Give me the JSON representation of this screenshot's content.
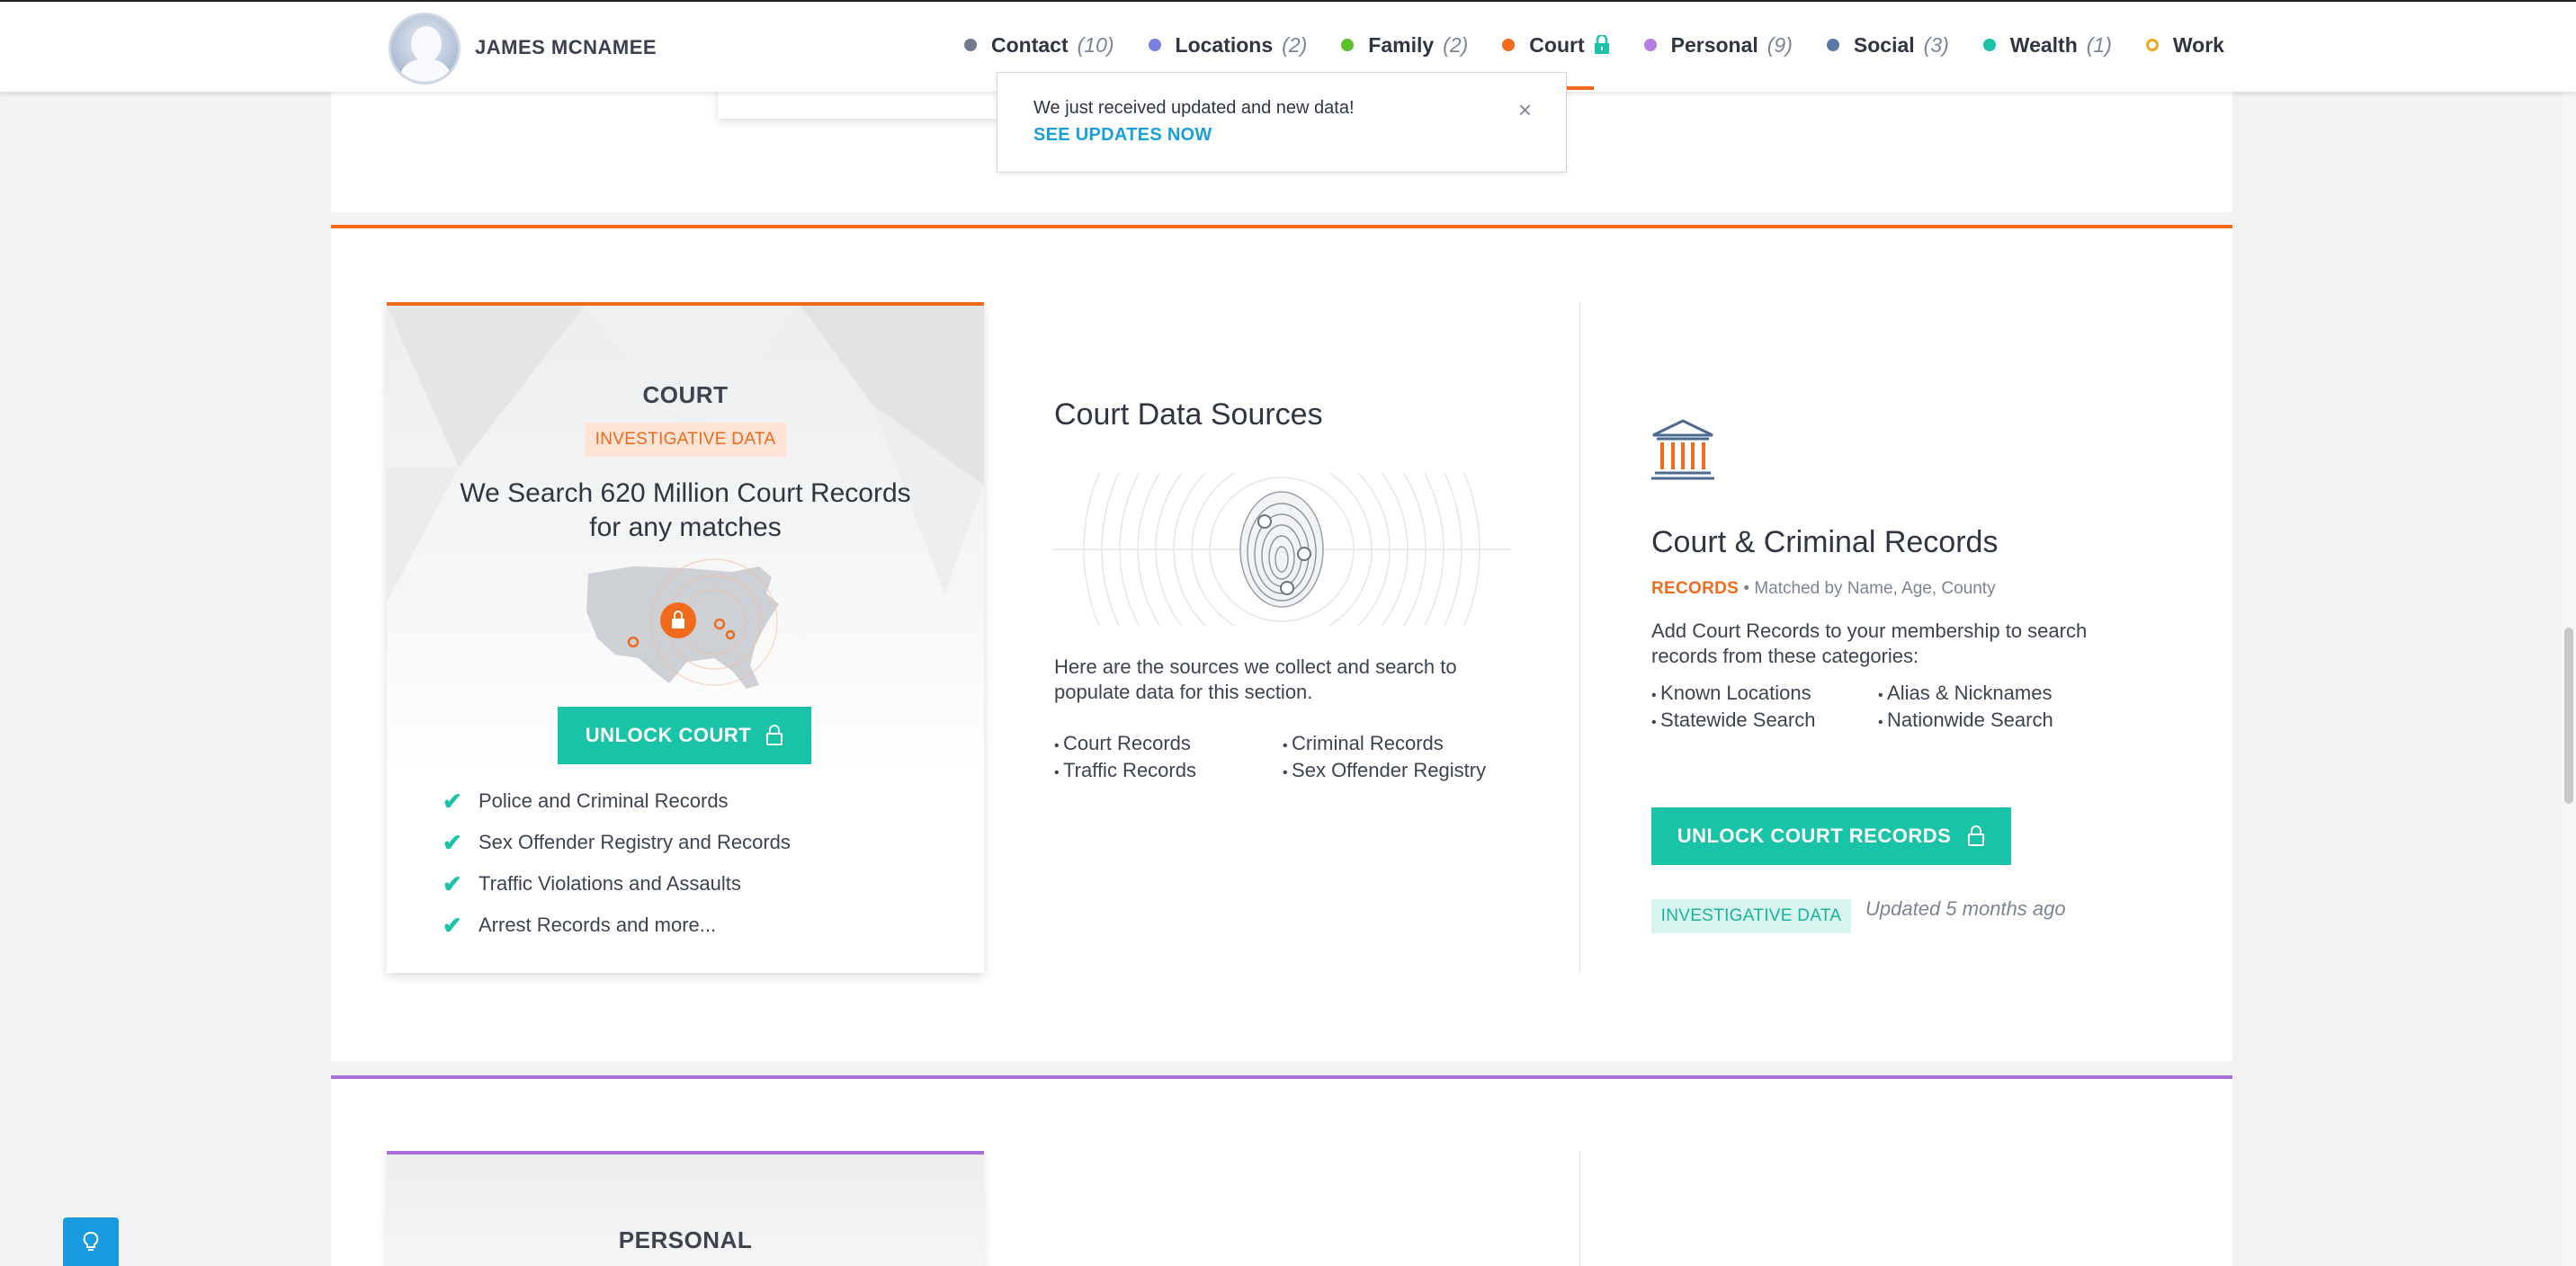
{
  "header": {
    "user_name": "JAMES MCNAMEE",
    "nav": [
      {
        "label": "Contact",
        "count": "(10)",
        "color": "#6f7a8c",
        "hollow": false,
        "locked": false
      },
      {
        "label": "Locations",
        "count": "(2)",
        "color": "#7b7fe0",
        "hollow": false,
        "locked": false
      },
      {
        "label": "Family",
        "count": "(2)",
        "color": "#5cc02e",
        "hollow": false,
        "locked": false
      },
      {
        "label": "Court",
        "count": "",
        "color": "#f26a1b",
        "hollow": false,
        "locked": true
      },
      {
        "label": "Personal",
        "count": "(9)",
        "color": "#b77de3",
        "hollow": false,
        "locked": false
      },
      {
        "label": "Social",
        "count": "(3)",
        "color": "#5a78a8",
        "hollow": false,
        "locked": false
      },
      {
        "label": "Wealth",
        "count": "(1)",
        "color": "#18c3a8",
        "hollow": false,
        "locked": false
      },
      {
        "label": "Work",
        "count": "",
        "color": "#f0a818",
        "hollow": true,
        "locked": false
      }
    ]
  },
  "notification": {
    "message": "We just received updated and new data!",
    "link": "SEE UPDATES NOW",
    "close": "×"
  },
  "court_card": {
    "title": "COURT",
    "badge": "INVESTIGATIVE DATA",
    "headline_line1": "We Search 620 Million Court Records",
    "headline_line2": "for any matches",
    "button": "UNLOCK COURT",
    "features": [
      "Police and Criminal Records",
      "Sex Offender Registry and Records",
      "Traffic Violations and Assaults",
      "Arrest Records and more..."
    ]
  },
  "data_sources": {
    "title": "Court Data Sources",
    "description": "Here are the sources we collect and search to populate data for this section.",
    "sources_col1": [
      "Court Records",
      "Traffic Records"
    ],
    "sources_col2": [
      "Criminal Records",
      "Sex Offender Registry"
    ]
  },
  "court_records": {
    "title": "Court & Criminal Records",
    "tag": "RECORDS",
    "matched": "Matched by Name, Age, County",
    "description": "Add Court Records to your membership to search records from these categories:",
    "categories_col1": [
      "Known Locations",
      "Statewide Search"
    ],
    "categories_col2": [
      "Alias & Nicknames",
      "Nationwide Search"
    ],
    "button": "UNLOCK COURT RECORDS",
    "badge": "INVESTIGATIVE DATA",
    "updated": "Updated 5 months ago"
  },
  "personal_card": {
    "title": "PERSONAL"
  },
  "colors": {
    "accent_orange": "#f26a1b",
    "accent_teal": "#18c3a8",
    "accent_purple": "#a86fd8",
    "help_blue": "#1a9be0"
  }
}
